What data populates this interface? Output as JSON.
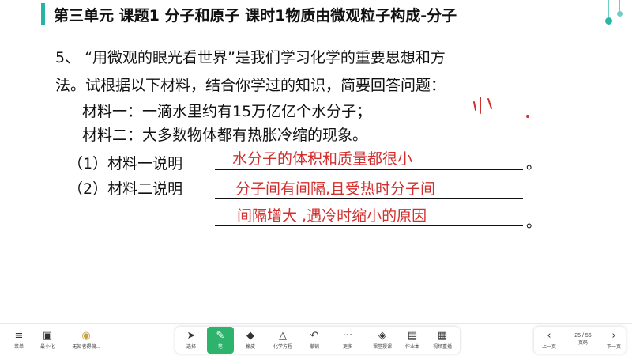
{
  "header": {
    "title": "第三单元 课题1 分子和原子 课时1物质由微观粒子构成-分子"
  },
  "question": {
    "line1": "5、 “用微观的眼光看世界”是我们学习化学的重要思想和方",
    "line2": "法。试根据以下材料，结合你学过的知识，简要回答问题：",
    "material1": "材料一：一滴水里约有15万亿亿个水分子；",
    "material2": "材料二：大多数物体都有热胀冷缩的现象。",
    "q1_label": "（1）材料一说明",
    "q2_label": "（2）材料二说明",
    "period": "。"
  },
  "answers": {
    "a1": "水分子的体积和质量都很小",
    "a2_line1": "分子间有间隔,且受热时分子间",
    "a2_line2": "间隔增大 ,遇冷时缩小的原因",
    "handwriting": "小."
  },
  "toolbar": {
    "left": [
      {
        "label": "菜单",
        "icon": "menu-icon"
      },
      {
        "label": "最小化",
        "icon": "minimize-icon"
      },
      {
        "label": "无知者得偏...",
        "icon": "app-icon"
      }
    ],
    "center": [
      {
        "label": "选择",
        "icon": "cursor-icon"
      },
      {
        "label": "笔",
        "icon": "pen-icon",
        "active": true
      },
      {
        "label": "橡皮",
        "icon": "eraser-icon"
      },
      {
        "label": "化学方程",
        "icon": "formula-icon"
      },
      {
        "label": "撤销",
        "icon": "undo-icon"
      },
      {
        "label": "更多",
        "icon": "more-icon"
      },
      {
        "label": "课堂授课",
        "icon": "class-icon"
      },
      {
        "label": "作业本",
        "icon": "homework-icon"
      },
      {
        "label": "视频重播",
        "icon": "replay-icon"
      }
    ],
    "right": {
      "prev_label": "上一页",
      "page": "25 / 56",
      "page_label": "页码",
      "next_label": "下一页"
    }
  },
  "colors": {
    "accent": "#27b3a6",
    "answer": "#d22f2f",
    "pen_active": "#2db36b"
  }
}
